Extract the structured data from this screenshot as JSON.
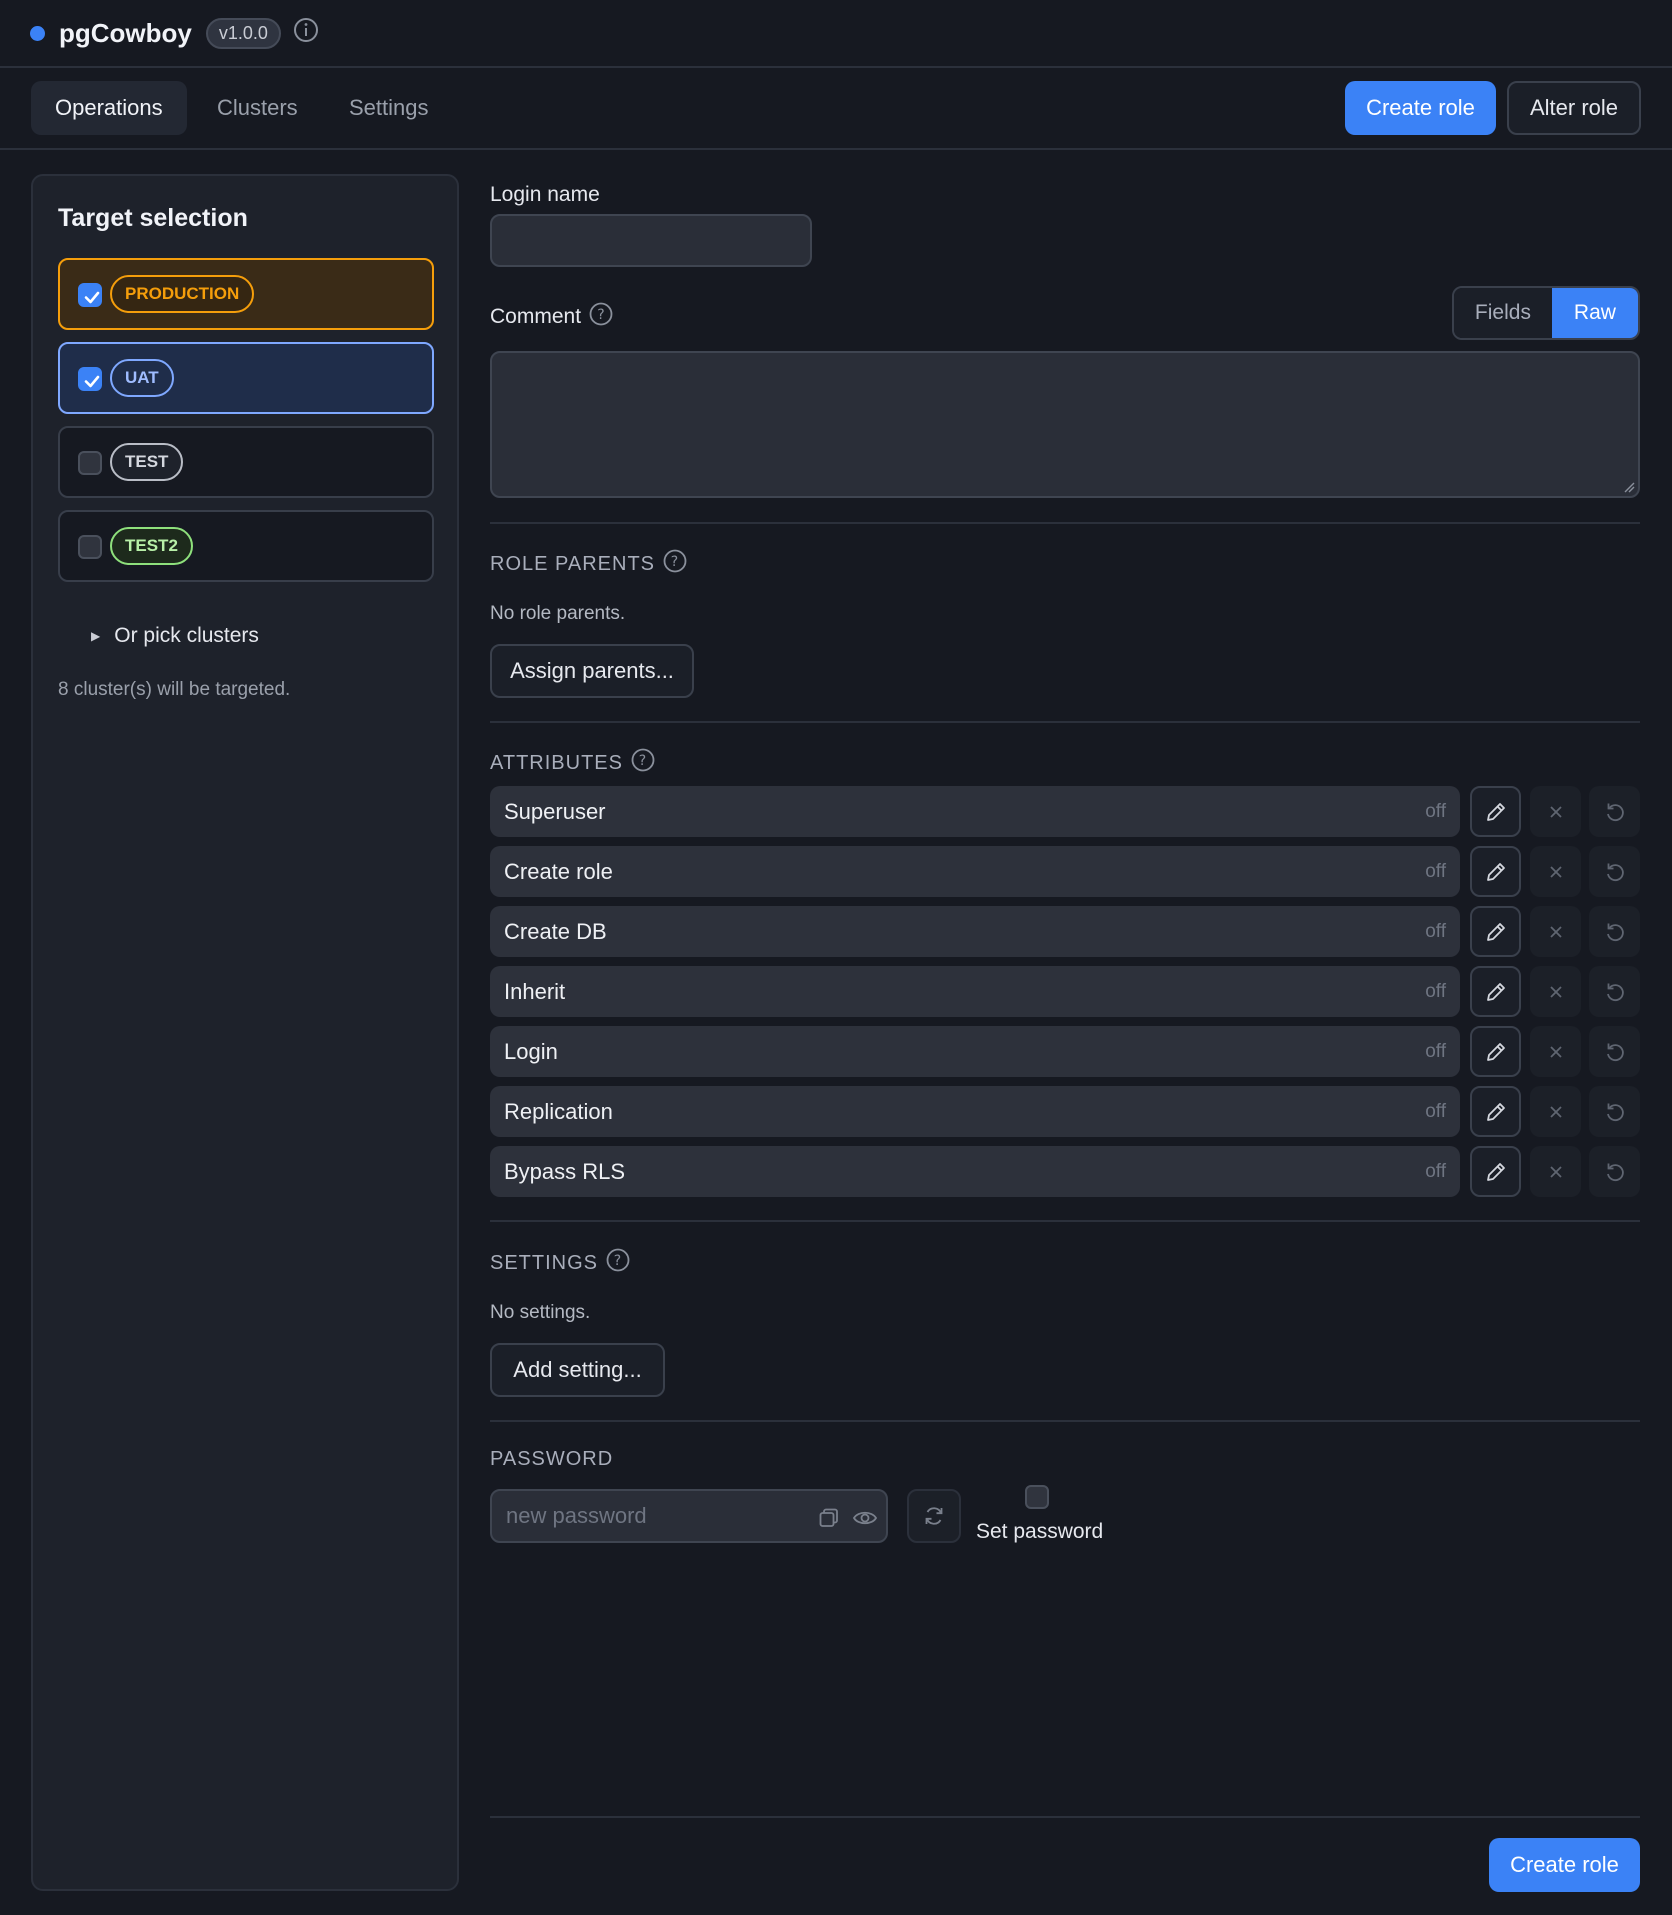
{
  "app": {
    "name": "pgCowboy",
    "version": "v1.0.0"
  },
  "nav": {
    "tabs": [
      {
        "label": "Operations",
        "active": true
      },
      {
        "label": "Clusters"
      },
      {
        "label": "Settings"
      }
    ],
    "create_role_label": "Create role",
    "alter_role_label": "Alter role"
  },
  "sidebar": {
    "title": "Target selection",
    "targets": [
      {
        "label": "PRODUCTION",
        "checked": true
      },
      {
        "label": "UAT",
        "checked": true
      },
      {
        "label": "TEST",
        "checked": false
      },
      {
        "label": "TEST2",
        "checked": false
      }
    ],
    "pick_clusters_label": "Or pick clusters",
    "targeted_text": "8 cluster(s) will be targeted."
  },
  "form": {
    "login_name_label": "Login name",
    "login_name_value": "",
    "comment_label": "Comment",
    "comment_value": "",
    "mode_fields": "Fields",
    "mode_raw": "Raw",
    "role_parents": {
      "title": "ROLE PARENTS",
      "empty_text": "No role parents.",
      "button": "Assign parents..."
    },
    "attributes": {
      "title": "ATTRIBUTES",
      "items": [
        {
          "name": "Superuser",
          "state": "off"
        },
        {
          "name": "Create role",
          "state": "off"
        },
        {
          "name": "Create DB",
          "state": "off"
        },
        {
          "name": "Inherit",
          "state": "off"
        },
        {
          "name": "Login",
          "state": "off"
        },
        {
          "name": "Replication",
          "state": "off"
        },
        {
          "name": "Bypass RLS",
          "state": "off"
        }
      ]
    },
    "settings": {
      "title": "SETTINGS",
      "empty_text": "No settings.",
      "button": "Add setting..."
    },
    "password": {
      "title": "PASSWORD",
      "placeholder": "new password",
      "set_password_label": "Set password"
    },
    "submit_label": "Create role"
  },
  "colors": {
    "accent": "#3b82f6",
    "production": "#f59e0b",
    "uat": "#7fa8ff",
    "test2": "#8ee07c",
    "background": "#161921"
  }
}
